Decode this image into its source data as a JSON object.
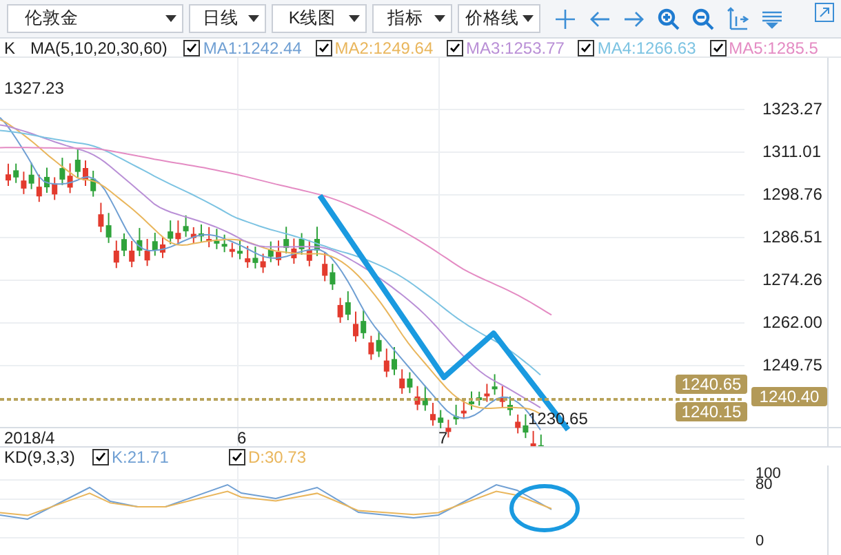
{
  "toolbar": {
    "dropdowns": [
      {
        "value": "伦敦金"
      },
      {
        "value": "日线"
      },
      {
        "value": "K线图"
      },
      {
        "value": "指标"
      },
      {
        "value": "价格线"
      }
    ]
  },
  "legend": {
    "type_label": "K",
    "ma_label": "MA(5,10,20,30,60)",
    "items": [
      {
        "label": "MA1:1242.44",
        "checked": true,
        "color": "#6f9fd3"
      },
      {
        "label": "MA2:1249.64",
        "checked": true,
        "color": "#e9b65c"
      },
      {
        "label": "MA3:1253.77",
        "checked": true,
        "color": "#b98fd6"
      },
      {
        "label": "MA4:1266.63",
        "checked": true,
        "color": "#7cc3e2"
      },
      {
        "label": "MA5:1285.5",
        "checked": true,
        "color": "#e48bc3"
      }
    ]
  },
  "price_chart": {
    "high_label": "1327.23",
    "low_label": "1230.65",
    "axis_labels": [
      "1323.27",
      "1311.01",
      "1298.76",
      "1286.51",
      "1274.26",
      "1262.00",
      "1249.75"
    ],
    "price_tags": [
      {
        "label": "1240.65",
        "kind": "upper"
      },
      {
        "label": "1240.40",
        "kind": "axis"
      },
      {
        "label": "1240.15",
        "kind": "lower"
      }
    ]
  },
  "date_labels": [
    "2018/4",
    "6",
    "7"
  ],
  "kd": {
    "label": "KD(9,3,3)",
    "items": [
      {
        "label": "K:21.71",
        "checked": true,
        "color": "#6f9fd3"
      },
      {
        "label": "D:30.73",
        "checked": true,
        "color": "#e9b65c"
      }
    ],
    "axis_labels": [
      "100",
      "80",
      "0"
    ]
  }
}
